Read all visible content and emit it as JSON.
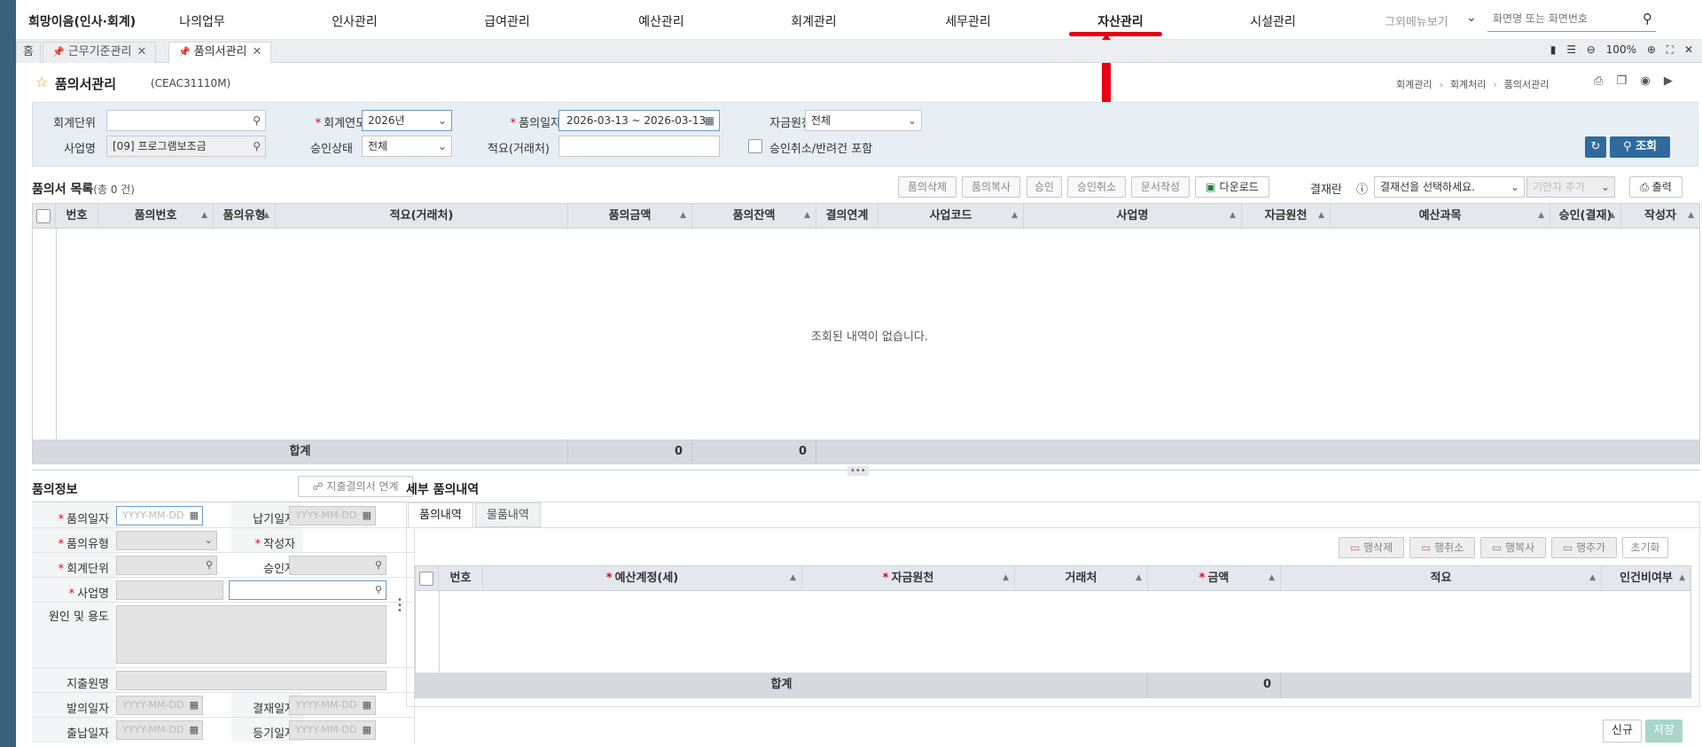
{
  "nav": {
    "brand": "희망이음(인사·회계)",
    "menus": [
      "나의업무",
      "인사관리",
      "급여관리",
      "예산관리",
      "회계관리",
      "세무관리",
      "자산관리",
      "시설관리"
    ],
    "other_menu": "그외메뉴보기",
    "search_placeholder": "화면명 또는 화면번호"
  },
  "tabs": {
    "home": "홈",
    "items": [
      "근무기준관리",
      "품의서관리"
    ],
    "zoom": "100%"
  },
  "page": {
    "title": "품의서관리",
    "code": "(CEAC31110M)",
    "breadcrumb": [
      "회계관리",
      "회계처리",
      "품의서관리"
    ]
  },
  "search": {
    "acct_unit_label": "회계단위",
    "fiscal_year_label": "회계연도",
    "fiscal_year_value": "2026년",
    "request_date_label": "품의일자",
    "request_date_value": "2026-03-13 ~ 2026-03-13",
    "fund_source_label": "자금원천",
    "fund_source_value": "전체",
    "project_label": "사업명",
    "project_value": "[09] 프로그램보조금",
    "approval_label": "승인상태",
    "approval_value": "전체",
    "summary_label": "적요(거래처)",
    "include_cancel_label": "승인취소/반려건 포함",
    "search_button": "조회"
  },
  "list": {
    "title": "품의서 목록",
    "count": "(총  0  건)",
    "buttons": [
      "품의삭제",
      "품의복사",
      "승인",
      "승인취소",
      "문서작성",
      "다운로드"
    ],
    "approval_line_label": "결재란",
    "approval_line_placeholder": "결재선을 선택하세요.",
    "proposer_add": "기안자 추가",
    "print_button": "출력",
    "columns": [
      "번호",
      "품의번호",
      "품의유형",
      "적요(거래처)",
      "품의금액",
      "품의잔액",
      "결의연계",
      "사업코드",
      "사업명",
      "자금원천",
      "예산과목",
      "승인(결재)",
      "작성자"
    ],
    "empty_message": "조회된 내역이 없습니다.",
    "total_label": "합계",
    "total_amount": "0",
    "total_balance": "0"
  },
  "info": {
    "title": "품의정보",
    "link_button": "지출결의서 연계",
    "date_placeholder": "YYYY-MM-DD",
    "labels": {
      "request_date": "품의일자",
      "due_date": "납기일자",
      "request_type": "품의유형",
      "writer": "작성자",
      "acct_unit": "회계단위",
      "approver": "승인자",
      "project": "사업명",
      "cause_usage": "원인 및 용도",
      "payee": "지출원명",
      "issue_date": "발의일자",
      "settle_date": "결재일자",
      "payment_date": "출납일자",
      "register_date": "등기일자"
    }
  },
  "detail": {
    "title": "세부 품의내역",
    "tabs": [
      "품의내역",
      "물품내역"
    ],
    "buttons": [
      "행삭제",
      "행취소",
      "행복사",
      "행추가",
      "초기화"
    ],
    "columns": [
      "번호",
      "예산계정(세)",
      "자금원천",
      "거래처",
      "금액",
      "적요",
      "인건비여부"
    ],
    "total_label": "합계",
    "total_amount": "0"
  },
  "footer": {
    "new_button": "신규",
    "save_button": "저장"
  },
  "colors": {
    "accent": "#2e6a9e",
    "highlight_arrow": "#e60012",
    "sidebar": "#3a5f78"
  }
}
